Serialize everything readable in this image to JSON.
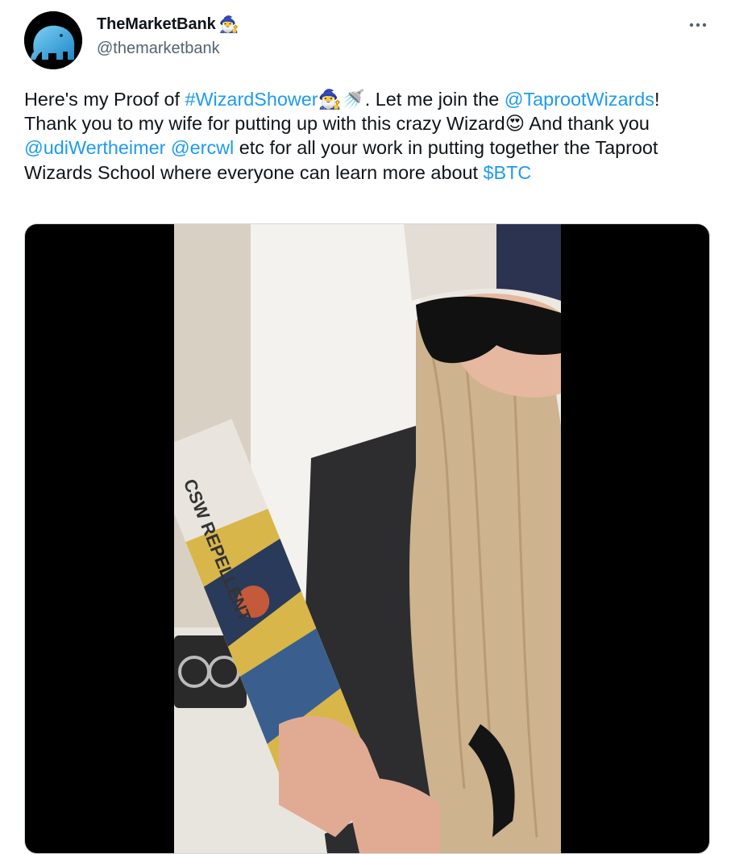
{
  "author": {
    "display_name": "TheMarketBank",
    "name_emoji": "🧙‍♂️",
    "handle": "@themarketbank",
    "avatar_icon": "elephant-avatar-icon"
  },
  "more_icon": "more-dots-icon",
  "tweet": {
    "t1": "Here's my Proof of ",
    "hashtag": "#WizardShower",
    "emoji1": "🧙‍♂️🚿",
    "t2": ". Let me join the ",
    "mention1": "@TaprootWizards",
    "t3": "! Thank you to my wife for putting up with this crazy Wizard",
    "emoji2": "😍",
    "t4": " And thank you ",
    "mention2": "@udiWertheimer",
    "t5": " ",
    "mention3": "@ercwl",
    "t6": " etc for all your work in putting together the Taproot Wizards School where everyone can learn more about ",
    "cashtag": "$BTC"
  },
  "media": {
    "type": "video",
    "label_text": "CSW REPELLENT",
    "colors": {
      "link": "#1d9bf0",
      "handle": "#536471",
      "letterbox": "#000000"
    }
  }
}
